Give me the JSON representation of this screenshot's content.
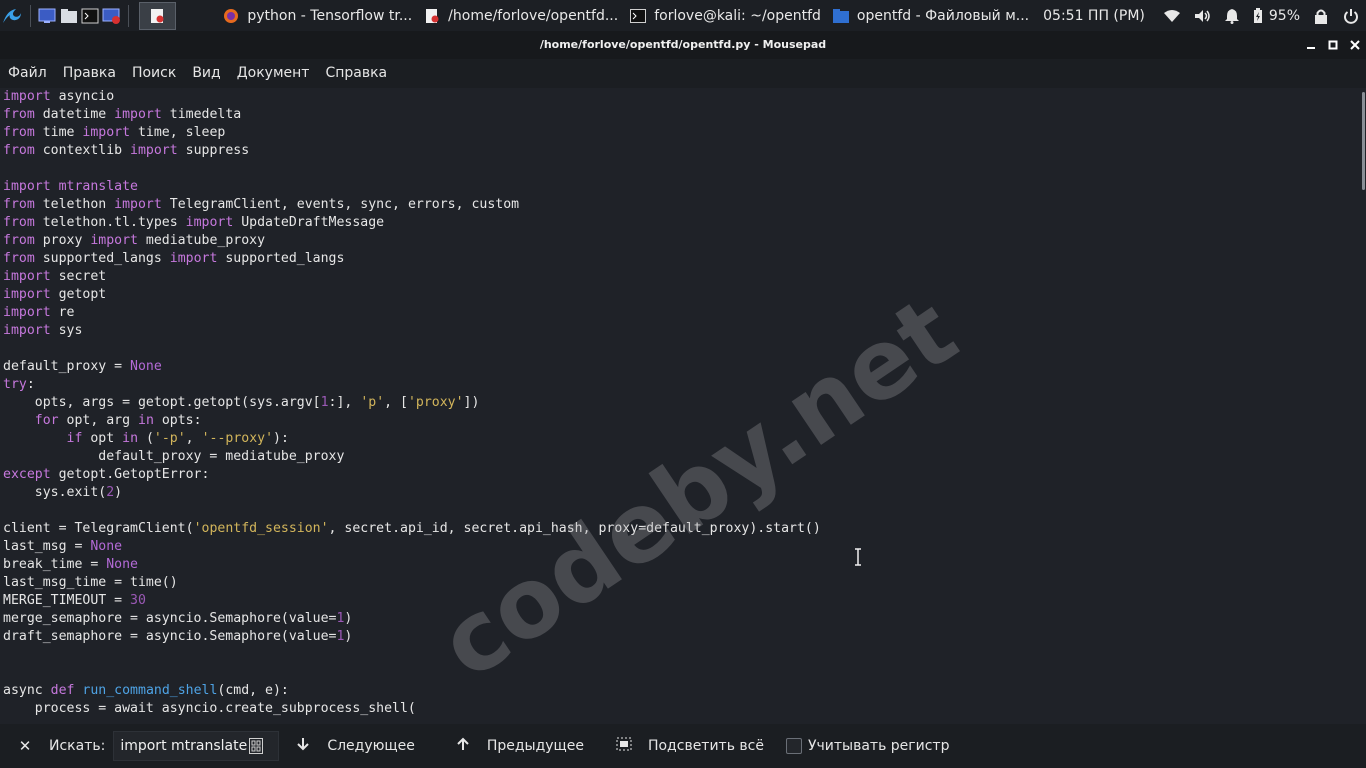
{
  "panel": {
    "tasks": [
      {
        "label": "python - Tensorflow tr...",
        "icon": "firefox-icon"
      },
      {
        "label": "/home/forlove/opentfd...",
        "icon": "text-editor-icon"
      },
      {
        "label": "forlove@kali: ~/opentfd",
        "icon": "terminal-icon"
      },
      {
        "label": "opentfd - Файловый м...",
        "icon": "folder-icon"
      }
    ],
    "clock": "05:51 ПП (PM)",
    "battery": "95%"
  },
  "window": {
    "title": "/home/forlove/opentfd/opentfd.py - Mousepad"
  },
  "menu": [
    "Файл",
    "Правка",
    "Поиск",
    "Вид",
    "Документ",
    "Справка"
  ],
  "code_lines": [
    [
      [
        "kw",
        "import"
      ],
      [
        "t",
        " asyncio"
      ]
    ],
    [
      [
        "kw",
        "from"
      ],
      [
        "t",
        " datetime "
      ],
      [
        "kw",
        "import"
      ],
      [
        "t",
        " timedelta"
      ]
    ],
    [
      [
        "kw",
        "from"
      ],
      [
        "t",
        " time "
      ],
      [
        "kw",
        "import"
      ],
      [
        "t",
        " time, sleep"
      ]
    ],
    [
      [
        "kw",
        "from"
      ],
      [
        "t",
        " contextlib "
      ],
      [
        "kw",
        "import"
      ],
      [
        "t",
        " suppress"
      ]
    ],
    [],
    [
      [
        "kw",
        "import"
      ],
      [
        "t",
        " "
      ],
      [
        "kw",
        "mtranslate"
      ]
    ],
    [
      [
        "kw",
        "from"
      ],
      [
        "t",
        " telethon "
      ],
      [
        "kw",
        "import"
      ],
      [
        "t",
        " TelegramClient, events, sync, errors, custom"
      ]
    ],
    [
      [
        "kw",
        "from"
      ],
      [
        "t",
        " telethon.tl.types "
      ],
      [
        "kw",
        "import"
      ],
      [
        "t",
        " UpdateDraftMessage"
      ]
    ],
    [
      [
        "kw",
        "from"
      ],
      [
        "t",
        " proxy "
      ],
      [
        "kw",
        "import"
      ],
      [
        "t",
        " mediatube_proxy"
      ]
    ],
    [
      [
        "kw",
        "from"
      ],
      [
        "t",
        " supported_langs "
      ],
      [
        "kw",
        "import"
      ],
      [
        "t",
        " supported_langs"
      ]
    ],
    [
      [
        "kw",
        "import"
      ],
      [
        "t",
        " secret"
      ]
    ],
    [
      [
        "kw",
        "import"
      ],
      [
        "t",
        " getopt"
      ]
    ],
    [
      [
        "kw",
        "import"
      ],
      [
        "t",
        " re"
      ]
    ],
    [
      [
        "kw",
        "import"
      ],
      [
        "t",
        " sys"
      ]
    ],
    [],
    [
      [
        "t",
        "default_proxy = "
      ],
      [
        "cst",
        "None"
      ]
    ],
    [
      [
        "kw",
        "try"
      ],
      [
        "t",
        ":"
      ]
    ],
    [
      [
        "t",
        "    opts, args = getopt.getopt(sys.argv["
      ],
      [
        "num",
        "1"
      ],
      [
        "t",
        ":], "
      ],
      [
        "str",
        "'p'"
      ],
      [
        "t",
        ", ["
      ],
      [
        "str",
        "'proxy'"
      ],
      [
        "t",
        "])"
      ]
    ],
    [
      [
        "t",
        "    "
      ],
      [
        "kw",
        "for"
      ],
      [
        "t",
        " opt, arg "
      ],
      [
        "kw",
        "in"
      ],
      [
        "t",
        " opts:"
      ]
    ],
    [
      [
        "t",
        "        "
      ],
      [
        "kw",
        "if"
      ],
      [
        "t",
        " opt "
      ],
      [
        "kw",
        "in"
      ],
      [
        "t",
        " ("
      ],
      [
        "str",
        "'-p'"
      ],
      [
        "t",
        ", "
      ],
      [
        "str",
        "'--proxy'"
      ],
      [
        "t",
        "):"
      ]
    ],
    [
      [
        "t",
        "            default_proxy = mediatube_proxy"
      ]
    ],
    [
      [
        "kw",
        "except"
      ],
      [
        "t",
        " getopt.GetoptError:"
      ]
    ],
    [
      [
        "t",
        "    sys.exit("
      ],
      [
        "num",
        "2"
      ],
      [
        "t",
        ")"
      ]
    ],
    [],
    [
      [
        "t",
        "client = TelegramClient("
      ],
      [
        "str",
        "'opentfd_session'"
      ],
      [
        "t",
        ", secret.api_id, secret.api_hash, proxy=default_proxy).start()"
      ]
    ],
    [
      [
        "t",
        "last_msg = "
      ],
      [
        "cst",
        "None"
      ]
    ],
    [
      [
        "t",
        "break_time = "
      ],
      [
        "cst",
        "None"
      ]
    ],
    [
      [
        "t",
        "last_msg_time = time()"
      ]
    ],
    [
      [
        "t",
        "MERGE_TIMEOUT = "
      ],
      [
        "num",
        "30"
      ]
    ],
    [
      [
        "t",
        "merge_semaphore = asyncio.Semaphore(value="
      ],
      [
        "num",
        "1"
      ],
      [
        "t",
        ")"
      ]
    ],
    [
      [
        "t",
        "draft_semaphore = asyncio.Semaphore(value="
      ],
      [
        "num",
        "1"
      ],
      [
        "t",
        ")"
      ]
    ],
    [],
    [],
    [
      [
        "t",
        "async "
      ],
      [
        "kw",
        "def"
      ],
      [
        "t",
        " "
      ],
      [
        "fn",
        "run_command_shell"
      ],
      [
        "t",
        "(cmd, e):"
      ]
    ],
    [
      [
        "t",
        "    process = await asyncio.create_subprocess_shell("
      ]
    ]
  ],
  "watermark": "codeby.net",
  "search": {
    "label": "Искать:",
    "value": "import mtranslate",
    "next": "Следующее",
    "prev": "Предыдущее",
    "highlight_all": "Подсветить всё",
    "match_case": "Учитывать регистр",
    "match_case_checked": false
  }
}
